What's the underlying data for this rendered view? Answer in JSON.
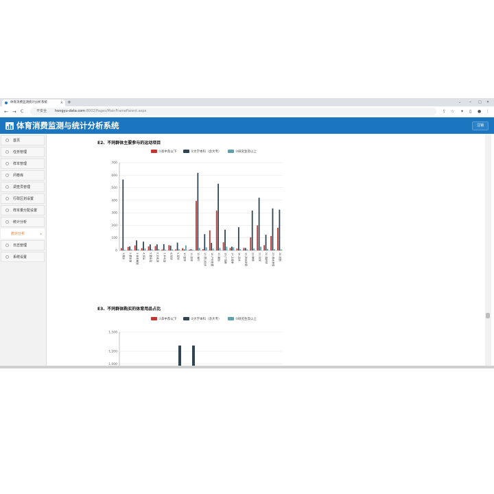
{
  "browser": {
    "tab_title": "体育消费监测统计分析系统",
    "tab_close": "×",
    "new_tab": "+",
    "security_label": "不安全",
    "url_host": "hongyu-data.com",
    "url_rest": ":8002/Pages/MainFrameParent.aspx",
    "nav_back": "←",
    "nav_forward": "→",
    "nav_reload": "C",
    "nav_home": "⌂"
  },
  "app": {
    "title": "体育消费监测与统计分析系统",
    "logout_label": "注销",
    "brand_color": "#1b76bf"
  },
  "sidebar": {
    "items": [
      {
        "label": "首页"
      },
      {
        "label": "任务管理"
      },
      {
        "label": "样本管理"
      },
      {
        "label": "问卷库"
      },
      {
        "label": "调查员管理"
      },
      {
        "label": "行政区划设置"
      },
      {
        "label": "样本量分配设置"
      },
      {
        "label": "统计分析"
      },
      {
        "label": "统计分析",
        "active": true
      },
      {
        "label": "日志管理"
      },
      {
        "label": "系统设置"
      }
    ]
  },
  "section1": {
    "title": "E2、不同群体主要参与的运动项目",
    "legend": [
      "①高中及以下",
      "②大学本科（含大专）",
      "③研究生及以上"
    ],
    "colors": [
      "#c23531",
      "#2f4554",
      "#61a0a8"
    ]
  },
  "section2": {
    "title": "E3、不同群体购买的体育用品占比",
    "legend": [
      "①高中及以下",
      "②大学本科（含大专）",
      "③研究生及以上"
    ]
  },
  "chart_data": [
    {
      "type": "bar",
      "title": "E2、不同群体主要参与的运动项目",
      "ylim": [
        0,
        700
      ],
      "yticks": [
        "0",
        "100",
        "200",
        "300",
        "400",
        "500",
        "600",
        "700"
      ],
      "categories": [
        "1.跑步",
        "2.健身操",
        "3.体育舞蹈",
        "4.游泳",
        "5.健身房",
        "6.羽毛球",
        "7.乒乓球",
        "8.网球",
        "9.足球",
        "10.篮球",
        "11.排球",
        "12.骑行",
        "13.登山徒步",
        "14.户外拓展",
        "15.瑜伽",
        "16.广场舞",
        "17.太极拳",
        "18.武术",
        "19.射击射箭",
        "20.棋牌",
        "21.台球",
        "22.保龄球",
        "23.滑冰滑雪",
        "24.其他"
      ],
      "series": [
        {
          "name": "①高中及以下",
          "values": [
            18,
            28,
            40,
            18,
            32,
            35,
            8,
            42,
            8,
            18,
            6,
            395,
            10,
            160,
            318,
            65,
            20,
            15,
            20,
            105,
            200,
            42,
            115,
            180,
            85,
            48,
            248
          ]
        },
        {
          "name": "②大学本科（含大专）",
          "values": [
            565,
            32,
            80,
            70,
            48,
            48,
            50,
            38,
            62,
            8,
            10,
            618,
            130,
            60,
            532,
            165,
            30,
            185,
            20,
            318,
            420,
            125,
            335,
            325,
            215,
            48
          ]
        },
        {
          "name": "③研究生及以上",
          "values": [
            5,
            8,
            10,
            15,
            10,
            12,
            5,
            8,
            10,
            40,
            5,
            20,
            25,
            15,
            20,
            30,
            25,
            10,
            8,
            15,
            30,
            12,
            10,
            8,
            12,
            5
          ]
        }
      ]
    },
    {
      "type": "bar",
      "title": "E3、不同群体购买的体育用品占比",
      "ylim": [
        0,
        1500
      ],
      "yticks": [
        "1,000",
        "1,200",
        "1,500"
      ],
      "series": [
        {
          "name": "①高中及以下",
          "values": []
        },
        {
          "name": "②大学本科（含大专）",
          "values": [
            1290,
            1290
          ]
        },
        {
          "name": "③研究生及以上",
          "values": []
        }
      ]
    }
  ]
}
